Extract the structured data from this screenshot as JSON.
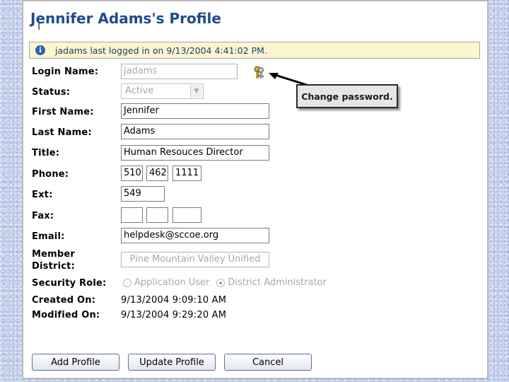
{
  "header": {
    "title": "Jennifer Adams's Profile"
  },
  "info": {
    "message": "jadams last logged in on 9/13/2004 4:41:02 PM.",
    "icon": "info-icon",
    "color": "#2c63b8"
  },
  "fields": {
    "login_name": {
      "label": "Login Name:",
      "value": "jadams"
    },
    "status": {
      "label": "Status:",
      "value": "Active"
    },
    "first_name": {
      "label": "First Name:",
      "value": "Jennifer"
    },
    "last_name": {
      "label": "Last Name:",
      "value": "Adams"
    },
    "title": {
      "label": "Title:",
      "value": "Human Resouces Director"
    },
    "phone": {
      "label": "Phone:",
      "area": "510",
      "prefix": "462",
      "line": "1111"
    },
    "ext": {
      "label": "Ext:",
      "value": "549"
    },
    "fax": {
      "label": "Fax:",
      "area": "",
      "prefix": "",
      "line": ""
    },
    "email": {
      "label": "Email:",
      "value": "helpdesk@sccoe.org"
    },
    "member_district": {
      "label_line1": "Member",
      "label_line2": "District:",
      "value": "Pine Mountain Valley Unified"
    },
    "security_role": {
      "label": "Security Role:",
      "options": [
        "Application User",
        "District Administrator"
      ],
      "selected": "District Administrator"
    },
    "created_on": {
      "label": "Created On:",
      "value": "9/13/2004 9:09:10 AM"
    },
    "modified_on": {
      "label": "Modified On:",
      "value": "9/13/2004 9:29:20 AM"
    }
  },
  "callout": {
    "text": "Change password.",
    "icon": "key-icon"
  },
  "buttons": {
    "add": "Add Profile",
    "update": "Update Profile",
    "cancel": "Cancel"
  },
  "colors": {
    "title": "#1f4b8a",
    "info_bar": "#fbf6cf",
    "background": "#c9d3ec"
  }
}
